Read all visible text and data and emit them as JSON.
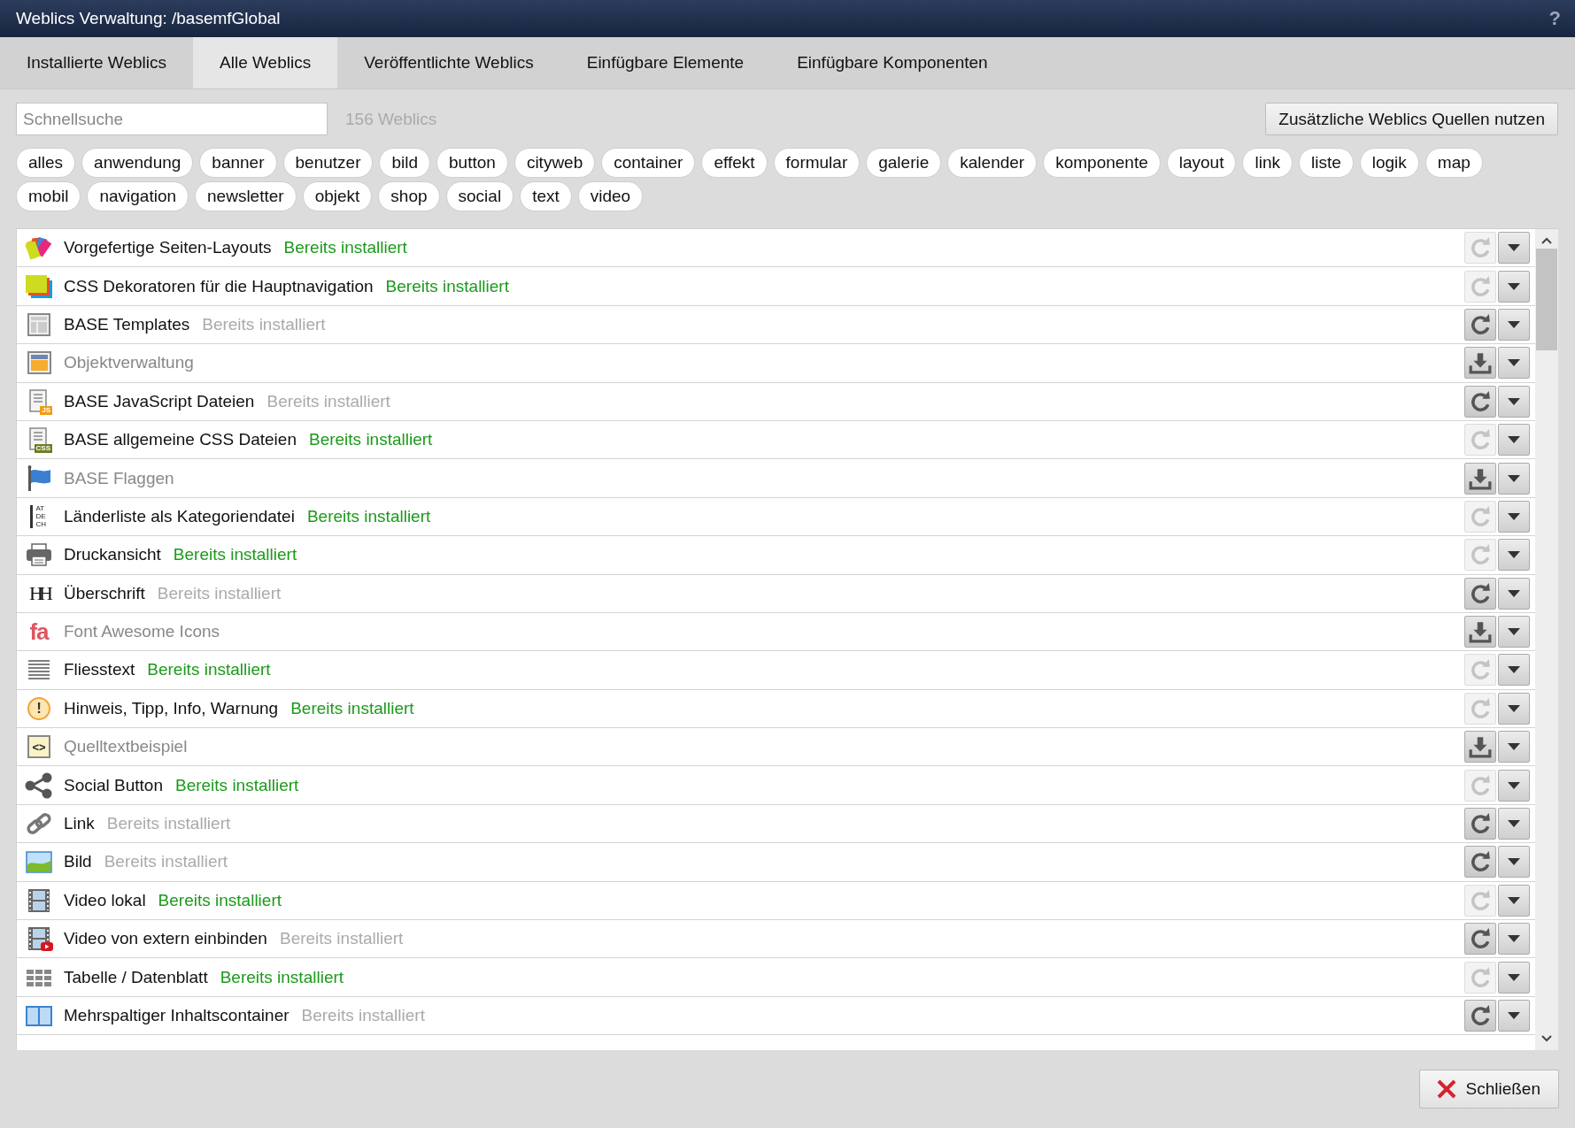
{
  "window": {
    "title": "Weblics Verwaltung: /basemfGlobal",
    "help": "?"
  },
  "tabs": [
    {
      "label": "Installierte Weblics",
      "selected": false
    },
    {
      "label": "Alle Weblics",
      "selected": true
    },
    {
      "label": "Veröffentlichte Weblics",
      "selected": false
    },
    {
      "label": "Einfügbare Elemente",
      "selected": false
    },
    {
      "label": "Einfügbare Komponenten",
      "selected": false
    }
  ],
  "search": {
    "placeholder": "Schnellsuche"
  },
  "count": "156 Weblics",
  "sources_button": "Zusätzliche Weblics Quellen nutzen",
  "tags": [
    "alles",
    "anwendung",
    "banner",
    "benutzer",
    "bild",
    "button",
    "cityweb",
    "container",
    "effekt",
    "formular",
    "galerie",
    "kalender",
    "komponente",
    "layout",
    "link",
    "liste",
    "logik",
    "map",
    "mobil",
    "navigation",
    "newsletter",
    "objekt",
    "shop",
    "social",
    "text",
    "video"
  ],
  "rows": [
    {
      "name": "Vorgefertige Seiten-Layouts",
      "installed": true,
      "status": "Bereits installiert",
      "up_to_date": true,
      "action": {
        "kind": "reload",
        "disabled": true
      }
    },
    {
      "name": "CSS Dekoratoren für die Hauptnavigation",
      "installed": true,
      "status": "Bereits installiert",
      "up_to_date": true,
      "action": {
        "kind": "reload",
        "disabled": true
      }
    },
    {
      "name": "BASE Templates",
      "installed": true,
      "status": "Bereits installiert",
      "up_to_date": false,
      "action": {
        "kind": "reload",
        "disabled": false
      }
    },
    {
      "name": "Objektverwaltung",
      "installed": false,
      "action": {
        "kind": "download",
        "disabled": false
      }
    },
    {
      "name": "BASE JavaScript Dateien",
      "installed": true,
      "status": "Bereits installiert",
      "up_to_date": false,
      "icon_text": "JS",
      "action": {
        "kind": "reload",
        "disabled": false
      }
    },
    {
      "name": "BASE allgemeine CSS Dateien",
      "installed": true,
      "status": "Bereits installiert",
      "up_to_date": true,
      "icon_text": "CSS",
      "action": {
        "kind": "reload",
        "disabled": true
      }
    },
    {
      "name": "BASE Flaggen",
      "installed": false,
      "action": {
        "kind": "download",
        "disabled": false
      }
    },
    {
      "name": "Länderliste als Kategoriendatei",
      "installed": true,
      "status": "Bereits installiert",
      "up_to_date": true,
      "icon_text": "AT DE CH",
      "action": {
        "kind": "reload",
        "disabled": true
      }
    },
    {
      "name": "Druckansicht",
      "installed": true,
      "status": "Bereits installiert",
      "up_to_date": true,
      "action": {
        "kind": "reload",
        "disabled": true
      }
    },
    {
      "name": "Überschrift",
      "installed": true,
      "status": "Bereits installiert",
      "up_to_date": false,
      "icon_text": "HH",
      "action": {
        "kind": "reload",
        "disabled": false
      }
    },
    {
      "name": "Font Awesome Icons",
      "installed": false,
      "icon_text": "fa",
      "action": {
        "kind": "download",
        "disabled": false
      }
    },
    {
      "name": "Fliesstext",
      "installed": true,
      "status": "Bereits installiert",
      "up_to_date": true,
      "action": {
        "kind": "reload",
        "disabled": true
      }
    },
    {
      "name": "Hinweis, Tipp, Info, Warnung",
      "installed": true,
      "status": "Bereits installiert",
      "up_to_date": true,
      "icon_text": "!",
      "action": {
        "kind": "reload",
        "disabled": true
      }
    },
    {
      "name": "Quelltextbeispiel",
      "installed": false,
      "icon_text": "<>",
      "action": {
        "kind": "download",
        "disabled": false
      }
    },
    {
      "name": "Social Button",
      "installed": true,
      "status": "Bereits installiert",
      "up_to_date": true,
      "action": {
        "kind": "reload",
        "disabled": true
      }
    },
    {
      "name": "Link",
      "installed": true,
      "status": "Bereits installiert",
      "up_to_date": false,
      "action": {
        "kind": "reload",
        "disabled": false
      }
    },
    {
      "name": "Bild",
      "installed": true,
      "status": "Bereits installiert",
      "up_to_date": false,
      "action": {
        "kind": "reload",
        "disabled": false
      }
    },
    {
      "name": "Video lokal",
      "installed": true,
      "status": "Bereits installiert",
      "up_to_date": true,
      "action": {
        "kind": "reload",
        "disabled": true
      }
    },
    {
      "name": "Video von extern einbinden",
      "installed": true,
      "status": "Bereits installiert",
      "up_to_date": false,
      "action": {
        "kind": "reload",
        "disabled": false
      }
    },
    {
      "name": "Tabelle / Datenblatt",
      "installed": true,
      "status": "Bereits installiert",
      "up_to_date": true,
      "action": {
        "kind": "reload",
        "disabled": true
      }
    },
    {
      "name": "Mehrspaltiger Inhaltscontainer",
      "installed": true,
      "status": "Bereits installiert",
      "up_to_date": false,
      "action": {
        "kind": "reload",
        "disabled": false
      }
    }
  ],
  "close_button": "Schließen"
}
